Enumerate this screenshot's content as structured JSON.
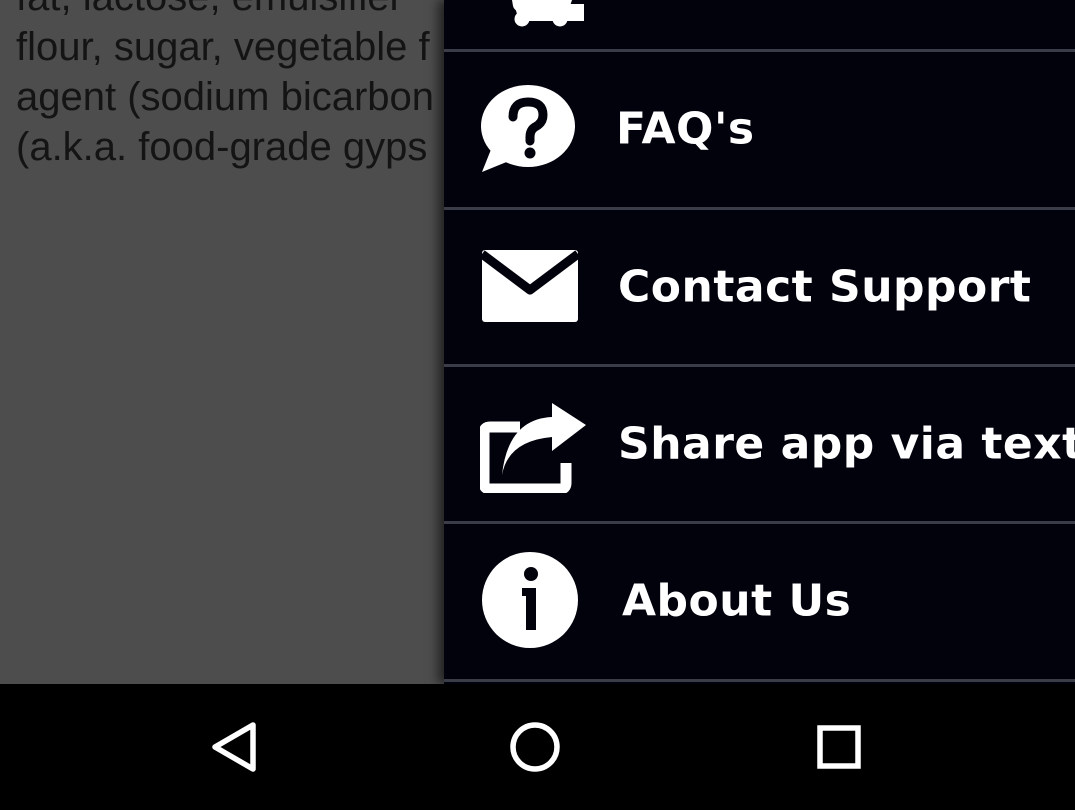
{
  "background": {
    "lines": [
      "fat, lactose, emulsifier",
      "flour, sugar, vegetable f",
      "agent (sodium bicarbon",
      "(a.k.a. food-grade gyps"
    ]
  },
  "drawer": {
    "items": [
      {
        "label": "",
        "icon": "cart-icon"
      },
      {
        "label": "FAQ's",
        "icon": "question-bubble-icon"
      },
      {
        "label": "Contact Support",
        "icon": "envelope-icon"
      },
      {
        "label": "Share app via text",
        "icon": "share-icon"
      },
      {
        "label": "About Us",
        "icon": "info-icon"
      }
    ]
  },
  "navbar": {
    "buttons": [
      "back-icon",
      "home-icon",
      "recents-icon"
    ]
  },
  "colors": {
    "drawer_bg": "#02020d",
    "divider": "#3a3d48",
    "dim_bg": "#4d4d4d",
    "text": "#ffffff"
  }
}
